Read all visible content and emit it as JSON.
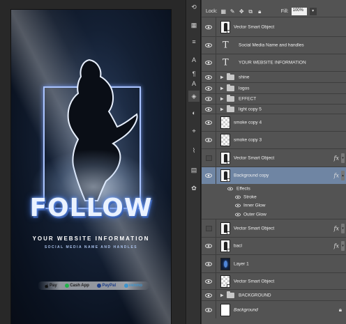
{
  "canvas": {
    "follow_text": "FOLLOW",
    "website_text": "YOUR WEBSITE INFORMATION",
    "social_text": "SOCIAL MEDIA NAME AND HANDLES",
    "payments": [
      {
        "label": "Pay",
        "icon": "apple-icon",
        "color": "#111111"
      },
      {
        "label": "Cash App",
        "icon": "cashapp-icon",
        "color": "#21b34a"
      },
      {
        "label": "PayPal",
        "icon": "paypal-icon",
        "color": "#1d3f8a"
      },
      {
        "label": "venmo",
        "icon": "venmo-icon",
        "color": "#3d95ce"
      }
    ]
  },
  "layers_panel": {
    "lock_label": "Lock:",
    "fill_label": "Fill:",
    "fill_value": "100%",
    "layers": [
      {
        "name": "Vector Smart Object",
        "kind": "smart",
        "visible": true
      },
      {
        "name": "Social Media Name and handles",
        "kind": "text",
        "visible": true
      },
      {
        "name": "YOUR WEBSITE INFORMATION",
        "kind": "text",
        "visible": true
      },
      {
        "name": "shine",
        "kind": "folder",
        "visible": true
      },
      {
        "name": "logos",
        "kind": "folder",
        "visible": true
      },
      {
        "name": "EFFECT",
        "kind": "folder",
        "visible": true
      },
      {
        "name": "light copy 5",
        "kind": "folder",
        "visible": true
      },
      {
        "name": "smoke copy 4",
        "kind": "checker",
        "visible": true
      },
      {
        "name": "smoke copy 3",
        "kind": "checker",
        "visible": true
      },
      {
        "name": "Vector Smart Object",
        "kind": "smart",
        "visible": false,
        "fx": "fx"
      },
      {
        "name": "Background copy",
        "kind": "smart",
        "visible": true,
        "fx": "fx",
        "selected": true
      },
      {
        "name": "Vector Smart Object",
        "kind": "smart",
        "visible": false,
        "fx": "fx"
      },
      {
        "name": "bacl",
        "kind": "smart",
        "visible": true,
        "fx": "fx"
      },
      {
        "name": "Layer 1",
        "kind": "dark",
        "visible": true
      },
      {
        "name": "Vector Smart Object",
        "kind": "smart",
        "visible": true
      },
      {
        "name": "BACKGROUND",
        "kind": "folder",
        "visible": true
      },
      {
        "name": "Background",
        "kind": "white",
        "visible": true,
        "locked": true
      }
    ],
    "effects_label": "Effects",
    "effects": [
      "Stroke",
      "Inner Glow",
      "Outer Glow"
    ]
  }
}
